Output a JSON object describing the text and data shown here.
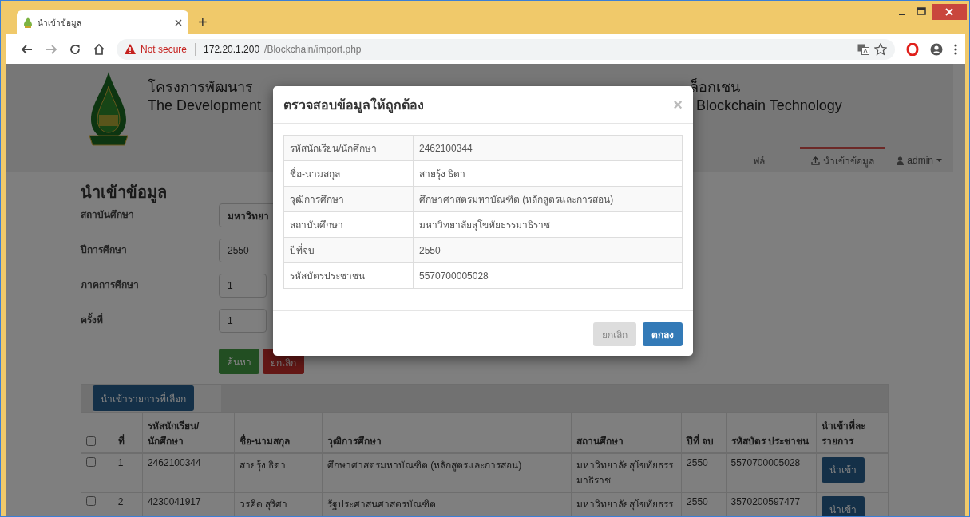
{
  "browser": {
    "tab_title": "นำเข้าข้อมูล",
    "new_tab": "+",
    "security": "Not secure",
    "url_host": "172.20.1.200",
    "url_path": "/Blockchain/import.php"
  },
  "header": {
    "title_th_left": "โครงการพัฒนาร",
    "title_th_right": "ล็อกเชน",
    "title_en_left": "The Development",
    "title_en_right": "Blockchain Technology"
  },
  "nav": [
    {
      "label": "ฟล์",
      "selected": false,
      "kind": "link"
    },
    {
      "label": "นำเข้าข้อมูล",
      "selected": true,
      "kind": "upload"
    },
    {
      "label": "admin",
      "selected": false,
      "kind": "dropdown"
    }
  ],
  "page_title": "นำเข้าข้อมูล",
  "form": {
    "fields": [
      {
        "label": "สถาบันศึกษา",
        "value": "มหาวิทยา",
        "kind": "select"
      },
      {
        "label": "ปีการศึกษา",
        "value": "2550",
        "kind": "wide"
      },
      {
        "label": "ภาคการศึกษา",
        "value": "1",
        "kind": "narrow"
      },
      {
        "label": "ครั้งที่",
        "value": "1",
        "kind": "narrow"
      }
    ],
    "buttons": [
      {
        "label": "ค้นหา",
        "kind": "success"
      },
      {
        "label": "ยกเลิก",
        "kind": "danger"
      }
    ]
  },
  "table": {
    "toolbar_button": "นำเข้ารายการที่เลือก",
    "header_checked": false,
    "columns": [
      "ที่",
      "รหัสนักเรียน/ นักศึกษา",
      "ชื่อ-นามสกุล",
      "วุฒิการศึกษา",
      "สถานศึกษา",
      "ปีที่ จบ",
      "รหัสบัตร ประชาชน",
      "นำเข้าที่ละ รายการ"
    ],
    "rows": [
      {
        "checked": false,
        "cells": [
          "1",
          "2462100344",
          "สายรุ้ง ธิดา",
          "ศึกษาศาสตรมหาบัณฑิต (หลักสูตรและการสอน)",
          "มหาวิทยาลัยสุโขทัยธรร มาธิราช",
          "2550",
          "5570700005028"
        ],
        "action": "นำเข้า"
      },
      {
        "checked": false,
        "cells": [
          "2",
          "4230041917",
          "วรคิด สุริศา",
          "รัฐประศาสนศาสตรบัณฑิต",
          "มหาวิทยาลัยสุโขทัยธรร",
          "2550",
          "3570200597477"
        ],
        "action": "นำเข้า"
      }
    ]
  },
  "modal": {
    "title": "ตรวจสอบข้อมูลให้ถูกต้อง",
    "close": "×",
    "rows": [
      {
        "label": "รหัสนักเรียน/นักศึกษา",
        "value": "2462100344"
      },
      {
        "label": "ชื่อ-นามสกุล",
        "value": "สายรุ้ง ธิดา"
      },
      {
        "label": "วุฒิการศึกษา",
        "value": "ศึกษาศาสตรมหาบัณฑิต (หลักสูตรและการสอน)"
      },
      {
        "label": "สถาบันศึกษา",
        "value": "มหาวิทยาลัยสุโขทัยธรรมาธิราช"
      },
      {
        "label": "ปีที่จบ",
        "value": "2550"
      },
      {
        "label": "รหัสบัตรประชาชน",
        "value": "5570700005028"
      }
    ],
    "buttons": [
      {
        "label": "ยกเลิก",
        "kind": "default"
      },
      {
        "label": "ตกลง",
        "kind": "primary"
      }
    ]
  }
}
